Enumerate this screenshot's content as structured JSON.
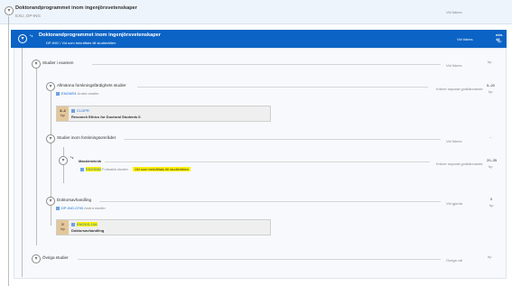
{
  "top": {
    "title": "Doktorandprogrammet inom ingenjörsvetenskaper",
    "subtitle": "EXU, DP-ING",
    "status": "Vid tidnes"
  },
  "banner": {
    "title": "Doktorandprogrammet inom ingenjörsvetenskaper",
    "subtitle": "DP-ING / Vid som bekräftats till studierätten",
    "status": "Vid tidnes",
    "credits_top": "min. 48",
    "credits_bottom": "hp"
  },
  "studier": {
    "label": "Studier i examen",
    "status": "Vid tidnes",
    "credits": "hp"
  },
  "allmanna": {
    "label": "Allmänna forskningsfärdighets studier",
    "code": "ENGMS1",
    "type": "Andra studier",
    "status": "Kräver separat godkännande",
    "credits": "5–20",
    "credits_unit": "hp",
    "course": {
      "badge_top": "3–2",
      "badge_bottom": "hp",
      "code": "CI-DPR",
      "name": "Research Ethics for Doctoral Students II"
    }
  },
  "inom": {
    "label": "Studier inom forskningsområdet",
    "status": "Vid tidnes",
    "credits": "–"
  },
  "maskin": {
    "label": "Maskinteknik",
    "code": "ENGS5M",
    "type": "Fortsatta studier",
    "highlight": "Vid som bekräftats till studierätten",
    "status": "Kräver separat godkännande",
    "credits": "20–35",
    "credits_unit": "hp"
  },
  "avhandling": {
    "label": "Doktorsavhandling",
    "code": "DP-ING-0700",
    "type": "Andra studier",
    "status": "Vid gjorda",
    "credits": "0",
    "credits_unit": "hp",
    "course": {
      "badge_top": "0",
      "badge_bottom": "hp",
      "code": "ENGDS-10A",
      "name": "Doktorsavhandling"
    }
  },
  "ovriga": {
    "label": "Övriga studier",
    "status": "Ovriga val",
    "credits": "hp"
  },
  "colors": {
    "accent": "#0b63c5",
    "highlight": "#fff200",
    "badge": "#e3c79a"
  },
  "icons": {
    "chevron": "chevron-down-icon",
    "course_tag": "course-tag-icon",
    "branch": "branch-icon"
  }
}
